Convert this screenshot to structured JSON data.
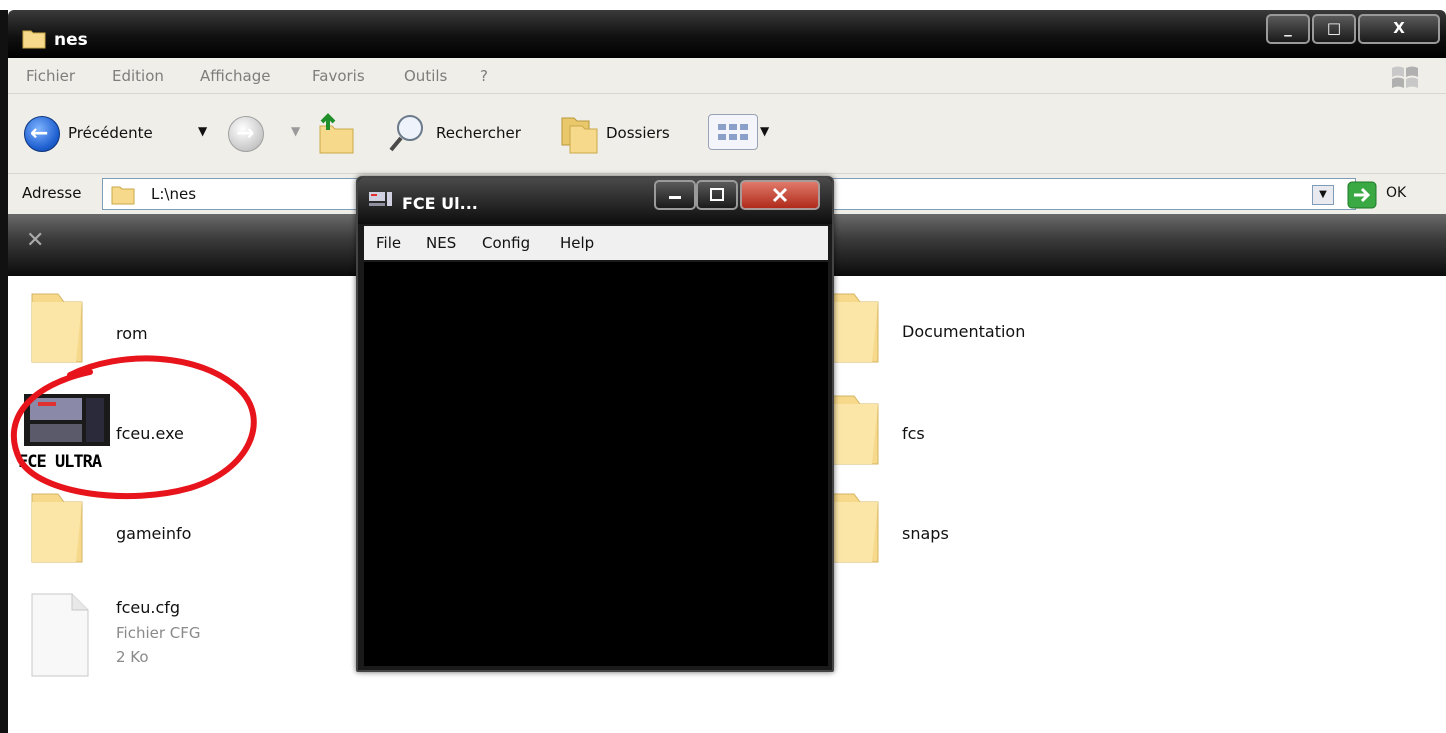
{
  "explorer": {
    "title": "nes",
    "caption_buttons": {
      "minimize": "_",
      "maximize": "□",
      "close": "X"
    },
    "menu": [
      "Fichier",
      "Edition",
      "Affichage",
      "Favoris",
      "Outils",
      "?"
    ],
    "toolbar": {
      "back_label": "Précédente",
      "search_label": "Rechercher",
      "folders_label": "Dossiers"
    },
    "address": {
      "label": "Adresse",
      "value": "L:\\nes",
      "go_label": "OK"
    },
    "files": [
      {
        "name": "rom",
        "type": "folder"
      },
      {
        "name": "Documentation",
        "type": "folder"
      },
      {
        "name": "fceu.exe",
        "type": "exe",
        "icon_text": "FCE ULTRA"
      },
      {
        "name": "fcs",
        "type": "folder"
      },
      {
        "name": "gameinfo",
        "type": "folder"
      },
      {
        "name": "snaps",
        "type": "folder"
      },
      {
        "name": "fceu.cfg",
        "type": "file",
        "type_label": "Fichier CFG",
        "size": "2 Ko"
      }
    ]
  },
  "fce_window": {
    "title": "FCE Ul...",
    "menu": [
      "File",
      "NES",
      "Config",
      "Help"
    ]
  },
  "annotation": {
    "color": "#e8141c",
    "target": "fceu.exe"
  },
  "colors": {
    "folder": "#f6d98a",
    "titlebar": "#111111",
    "annotation": "#e8141c"
  }
}
